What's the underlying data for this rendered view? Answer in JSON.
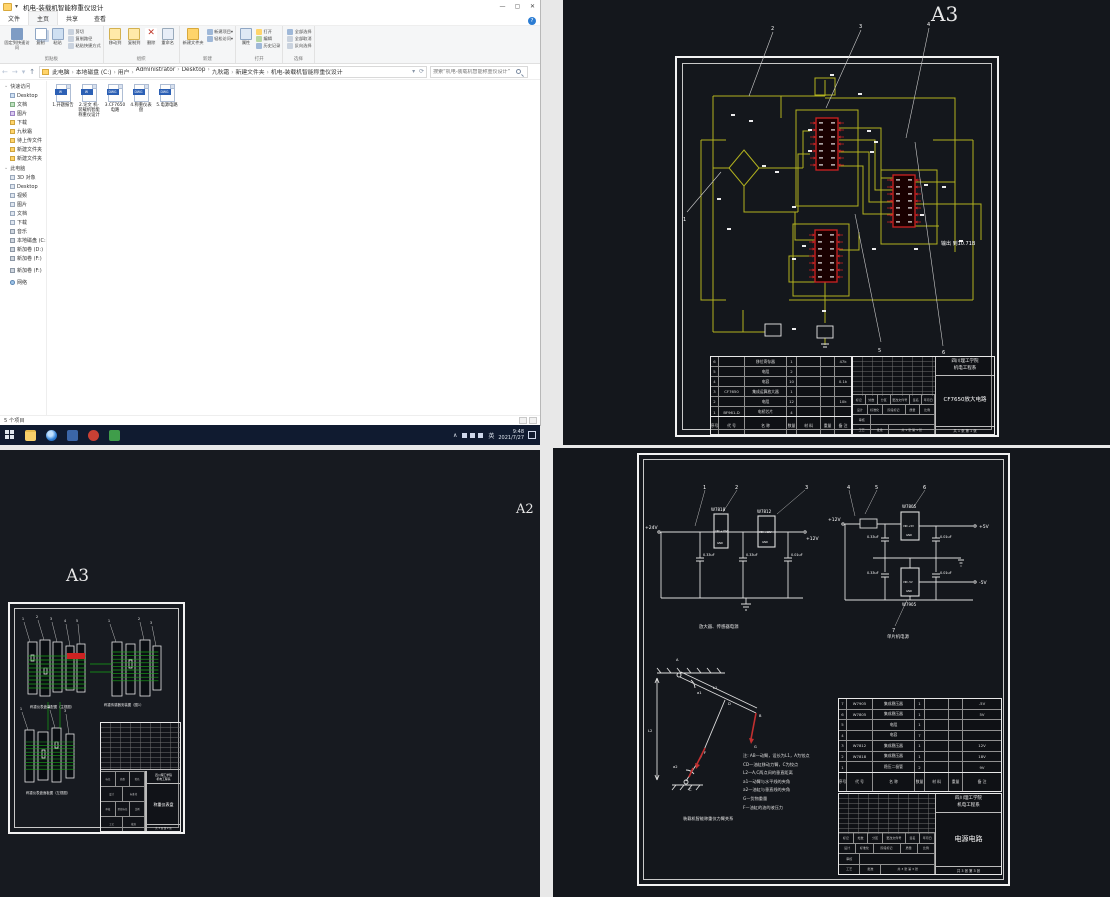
{
  "icons": {
    "back": "←",
    "fwd": "→",
    "up": "↑",
    "dropdown": "▾",
    "min": "—",
    "max": "▢",
    "close": "✕",
    "help": "?",
    "chev_up": "∧",
    "refresh": "⟳",
    "cut_label_icon": "✂",
    "delete_x": "✕"
  },
  "explorer": {
    "title": "机电-装载机智能称重仪设计",
    "tabs": [
      {
        "label": "文件"
      },
      {
        "label": "主页"
      },
      {
        "label": "共享"
      },
      {
        "label": "查看"
      }
    ],
    "ribbon": {
      "pin_quick": "固定到快速访问",
      "copy": "复制",
      "paste": "粘贴",
      "cut": "剪切",
      "copy_path": "复制路径",
      "paste_shortcut": "粘贴快捷方式",
      "group_clipboard": "剪贴板",
      "move_to": "移动到",
      "copy_to": "复制到",
      "delete": "删除",
      "rename": "重命名",
      "group_organize": "组织",
      "new_folder": "新建文件夹",
      "new_item": "新建项目",
      "easy_access": "轻松访问",
      "group_new": "新建",
      "properties": "属性",
      "open": "打开",
      "edit": "编辑",
      "history": "历史记录",
      "group_open": "打开",
      "select_all": "全部选择",
      "select_none": "全部取消",
      "invert_sel": "反向选择",
      "group_select": "选择"
    },
    "breadcrumb": [
      "此电脑",
      "本地磁盘 (C:)",
      "用户",
      "Administrator",
      "Desktop",
      "九秋霜",
      "新建文件夹",
      "机电-装载机智能称重仪设计"
    ],
    "search_placeholder": "搜索“机电-装载机智能称重仪设计”",
    "sidebar": {
      "quick_access": "快速访问",
      "quick_items": [
        "Desktop",
        "文档",
        "图片",
        "下载",
        "九秋霜",
        "待上传文件",
        "新建文件夹",
        "新建文件夹"
      ],
      "this_pc": "此电脑",
      "pc_items": [
        "3D 对象",
        "Desktop",
        "视频",
        "图片",
        "文档",
        "下载",
        "音乐",
        "本地磁盘 (C:)",
        "新加卷 (D:)",
        "新加卷 (F:)"
      ],
      "extra_drive": "新加卷 (F:)",
      "network": "网络"
    },
    "files": [
      {
        "name": "1.开题报告",
        "badge": "W"
      },
      {
        "name": "2.论文 机-装载机智能称重仪设计",
        "badge": "W"
      },
      {
        "name": "3.CF7650电路",
        "badge": "DWG"
      },
      {
        "name": "4.称重仪表盘",
        "badge": "DWG"
      },
      {
        "name": "5.电源电路",
        "badge": "DWG"
      }
    ],
    "status_count": "5 个项目"
  },
  "taskbar": {
    "lang": "英",
    "time": "9:48",
    "date": "2021/7/27"
  },
  "shared_tb": {
    "school": "四川理工学院",
    "dept": "机电工程系",
    "mark": "标记",
    "count": "处数",
    "zone": "分区",
    "change_no": "更改文件号",
    "sign": "签名",
    "ymd": "年月日",
    "design": "设计",
    "standard": "标准化",
    "stage": "阶段标记",
    "weight": "质量",
    "scale": "比例",
    "check": "审核",
    "craft": "工艺",
    "approve": "批准"
  },
  "bom_header": [
    "序号",
    "代 号",
    "名  称",
    "数量",
    "材 料",
    "重量",
    "备 注"
  ],
  "cad_tr": {
    "sheet": "A3",
    "output_label": "输出 到10.71B",
    "callouts": [
      "1",
      "2",
      "3",
      "4",
      "5",
      "6"
    ],
    "title": "CF7650放大电路",
    "sheet_info": "共 1 张 第 1 张",
    "bom_rows": [
      [
        "6",
        "",
        "移位寄存器",
        "1",
        "",
        "",
        "47k"
      ],
      [
        "5",
        "",
        "电阻",
        "2",
        "",
        "",
        ""
      ],
      [
        "4",
        "",
        "电容",
        "10",
        "",
        "",
        "0.1k"
      ],
      [
        "3",
        "CF7650",
        "集成运算放大器",
        "1",
        "",
        "",
        ""
      ],
      [
        "2",
        "",
        "电阻",
        "12",
        "",
        "",
        "10k"
      ],
      [
        "1",
        "BF961-D",
        "电桥芯片",
        "4",
        "",
        "",
        ""
      ]
    ]
  },
  "cad_bl": {
    "sheet_a2": "A2",
    "sheet": "A3",
    "captions": [
      "称重仪表盘装配图（主视图）",
      "称重传感器安装图（图1）",
      "称重仪表盘面板图（左视图）"
    ],
    "title": "称重仪表盘",
    "sheet_info": "共 3 张 第 2 张"
  },
  "cad_br": {
    "callouts": [
      "1",
      "2",
      "3",
      "4",
      "5",
      "6",
      "7"
    ],
    "labels": {
      "in24": "+24V",
      "out12": "+12V",
      "in12": "+12V",
      "out5": "+5V",
      "out5n": "-5V"
    },
    "regs": [
      {
        "name": "W7818",
        "pin": "VIN +18V",
        "gnd": "GND"
      },
      {
        "name": "W7812",
        "pin": "VIN +12V",
        "gnd": "GND"
      },
      {
        "name": "W7805",
        "pin": "VIN +5V",
        "gnd": "GND"
      },
      {
        "name": "W7905",
        "pin": "VIN -5V",
        "gnd": "GND"
      }
    ],
    "caps": [
      "0.33uF",
      "0.33uF",
      "0.01uF",
      "0.33uF",
      "0.01uF",
      "0.33uF",
      "0.01uF"
    ],
    "caption_left": "放大器、传感器电源",
    "caption_right": "单片机电源",
    "linkage": {
      "pt_a": "A",
      "pt_b": "B",
      "pt_c": "C",
      "pt_d": "D",
      "pt_f": "F",
      "dim_l1": "L1",
      "dim_l2": "L2",
      "ang1": "a1",
      "ang2": "a2",
      "force_g": "G",
      "caption": "装载机智能称重仪力臂关系"
    },
    "notes": [
      "注: AB—动臂，设长为L1，A为铰点",
      "CD—油缸移动力臂，C为铰点",
      "L2—A,C两点间的垂直距离",
      "a1—动臂与水平线的夹角",
      "a2—油缸与垂直线的夹角",
      "G—货物重量",
      "F—油缸的油的液压力"
    ],
    "title": "电源电路",
    "sheet_info": "共 3 张 第 3 张",
    "bom_rows": [
      [
        "7",
        "W7905",
        "集成稳压器",
        "1",
        "",
        "",
        "-5V"
      ],
      [
        "6",
        "W7805",
        "集成稳压器",
        "1",
        "",
        "",
        "5V"
      ],
      [
        "5",
        "",
        "电阻",
        "1",
        "",
        "",
        ""
      ],
      [
        "4",
        "",
        "电容",
        "7",
        "",
        "",
        ""
      ],
      [
        "3",
        "W7812",
        "集成稳压器",
        "1",
        "",
        "",
        "12V"
      ],
      [
        "2",
        "W7818",
        "集成稳压器",
        "1",
        "",
        "",
        "18V"
      ],
      [
        "1",
        "",
        "稳压二极管",
        "2",
        "",
        "",
        "9V"
      ]
    ]
  }
}
